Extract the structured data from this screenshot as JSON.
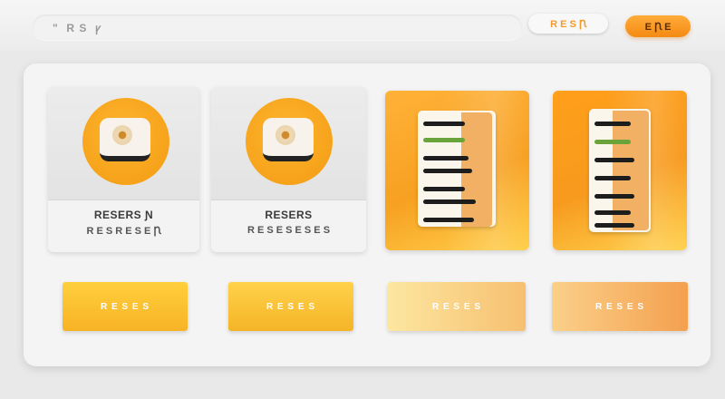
{
  "header": {
    "search_text": "\" ⁠ R S ⁠ ꝩ",
    "outline_button": "R E S Ꞃ",
    "primary_button": "E Ꞃ E"
  },
  "cards": [
    {
      "title": "RESERS Ɲ",
      "subtitle": "R E S R E S E Ꞃ"
    },
    {
      "title": "RESERS",
      "subtitle": "R E S  E S E S E S"
    }
  ],
  "buttons": [
    {
      "label": "R E S E S"
    },
    {
      "label": "R E S E S"
    },
    {
      "label": "R E S E S"
    },
    {
      "label": "R E S E S"
    }
  ],
  "colors": {
    "accent": "#f39b12",
    "accent_light": "#ffcf3c",
    "background": "#e9e9e9",
    "panel": "#f4f4f4",
    "line_green": "#6aa33a"
  },
  "icons": {
    "card1": "telephone-icon",
    "card2": "telephone-icon",
    "doc1": "document-list-icon",
    "doc2": "document-list-icon"
  }
}
